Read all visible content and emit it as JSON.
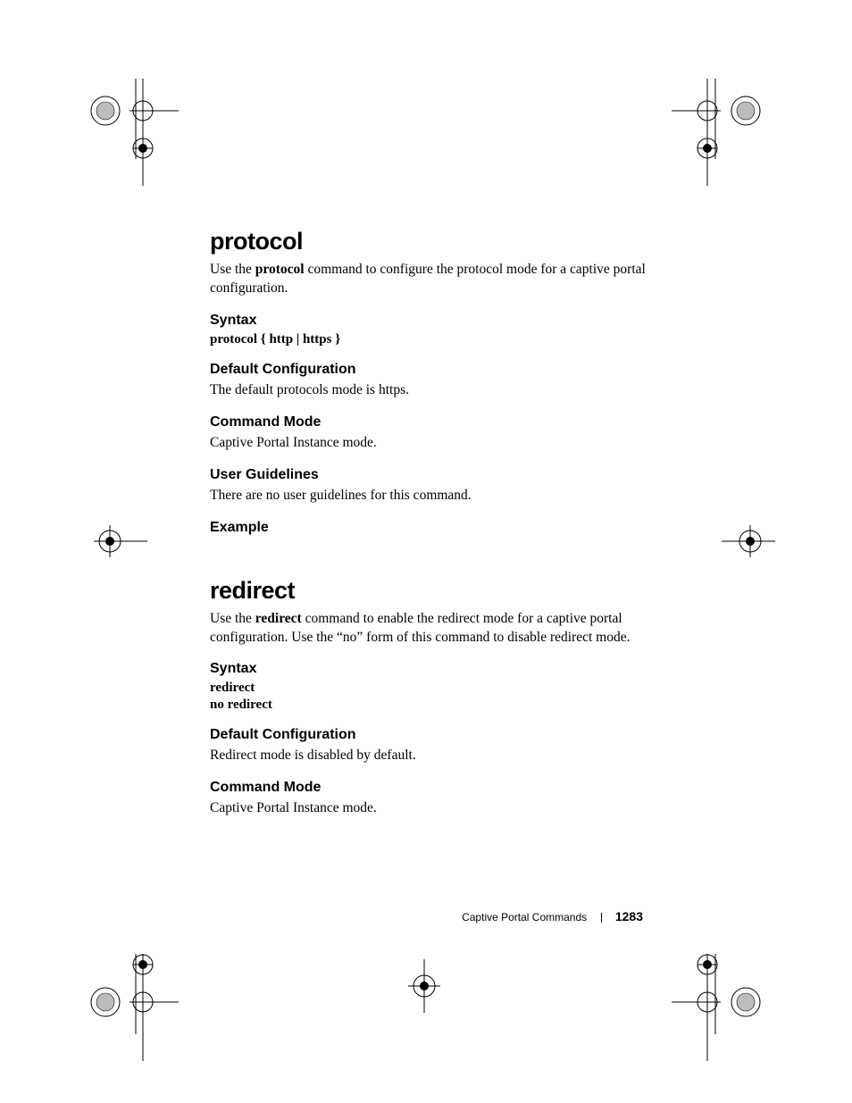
{
  "section1": {
    "title": "protocol",
    "intro_pre": "Use the ",
    "intro_bold": "protocol",
    "intro_post": " command to configure the protocol mode for a captive portal configuration.",
    "syntax_heading": "Syntax",
    "syntax_line": "protocol { http | https }",
    "default_heading": "Default Configuration",
    "default_body": "The default protocols mode is https.",
    "mode_heading": "Command Mode",
    "mode_body": "Captive Portal Instance mode.",
    "guidelines_heading": "User Guidelines",
    "guidelines_body": "There are no user guidelines for this command.",
    "example_heading": "Example"
  },
  "section2": {
    "title": "redirect",
    "intro_pre": "Use the ",
    "intro_bold": "redirect",
    "intro_post": " command to enable the redirect mode for a captive portal configuration. Use the “no” form of this command to disable redirect mode.",
    "syntax_heading": "Syntax",
    "syntax_line1": "redirect",
    "syntax_line2": "no redirect",
    "default_heading": "Default Configuration",
    "default_body": "Redirect mode is disabled by default.",
    "mode_heading": "Command Mode",
    "mode_body": "Captive Portal Instance mode."
  },
  "footer": {
    "chapter": "Captive Portal Commands",
    "page": "1283"
  }
}
